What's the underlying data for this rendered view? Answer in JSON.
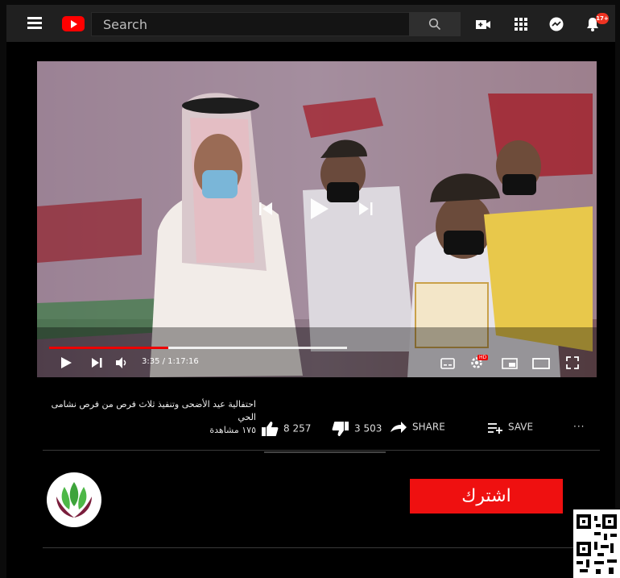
{
  "header": {
    "search_placeholder": "Search",
    "notification_count": "17+"
  },
  "player": {
    "time": "3:35 / 1:17:16",
    "progress": 0.4,
    "hd_badge": "HD"
  },
  "video": {
    "title": "احتفالية عيد الأضحى وتنفيذ ثلاث فرص من فرص نشامى الحي",
    "views": "١٧٥ مشاهدة",
    "likes": "8 257",
    "dislikes": "3 503",
    "share_label": "SHARE",
    "save_label": "SAVE",
    "more_label": "···"
  },
  "channel": {
    "subscribe_label": "اشترك"
  },
  "colors": {
    "brand_red": "#ff0000",
    "subscribe_red": "#ef1010",
    "topbar": "#202020"
  }
}
